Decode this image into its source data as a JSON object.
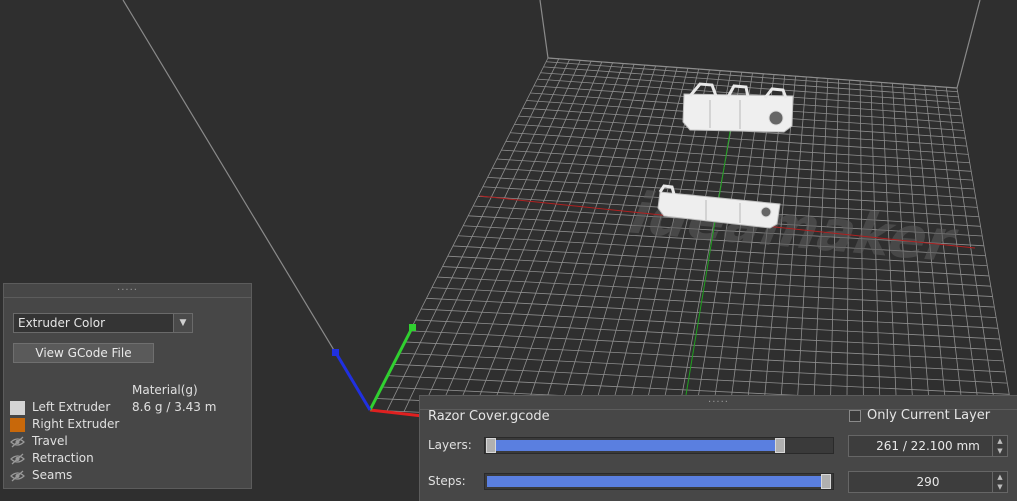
{
  "viewport": {
    "watermark": "ideamaker",
    "grid_color": "#8e8e8e",
    "axis_colors": {
      "x": "#e02020",
      "y": "#30d030",
      "z": "#2030e0"
    }
  },
  "left_panel": {
    "view_mode": "Extruder Color",
    "view_gcode_label": "View GCode File",
    "material_title": "Material(g)",
    "material_value": "8.6 g / 3.43 m",
    "legend": [
      {
        "label": "Left Extruder",
        "color": "#d4d4d4",
        "icon": "color-swatch"
      },
      {
        "label": "Right Extruder",
        "color": "#c8680a",
        "icon": "color-swatch"
      },
      {
        "label": "Travel",
        "icon": "eye-hidden-icon"
      },
      {
        "label": "Retraction",
        "icon": "eye-hidden-icon"
      },
      {
        "label": "Seams",
        "icon": "eye-hidden-icon"
      }
    ]
  },
  "bottom_panel": {
    "file_name": "Razor Cover.gcode",
    "only_current_layer_label": "Only Current Layer",
    "only_current_layer_checked": false,
    "layers_label": "Layers:",
    "layers_value": "261 / 22.100 mm",
    "layers_fraction": 0.85,
    "steps_label": "Steps:",
    "steps_value": "290",
    "steps_fraction": 1.0
  }
}
